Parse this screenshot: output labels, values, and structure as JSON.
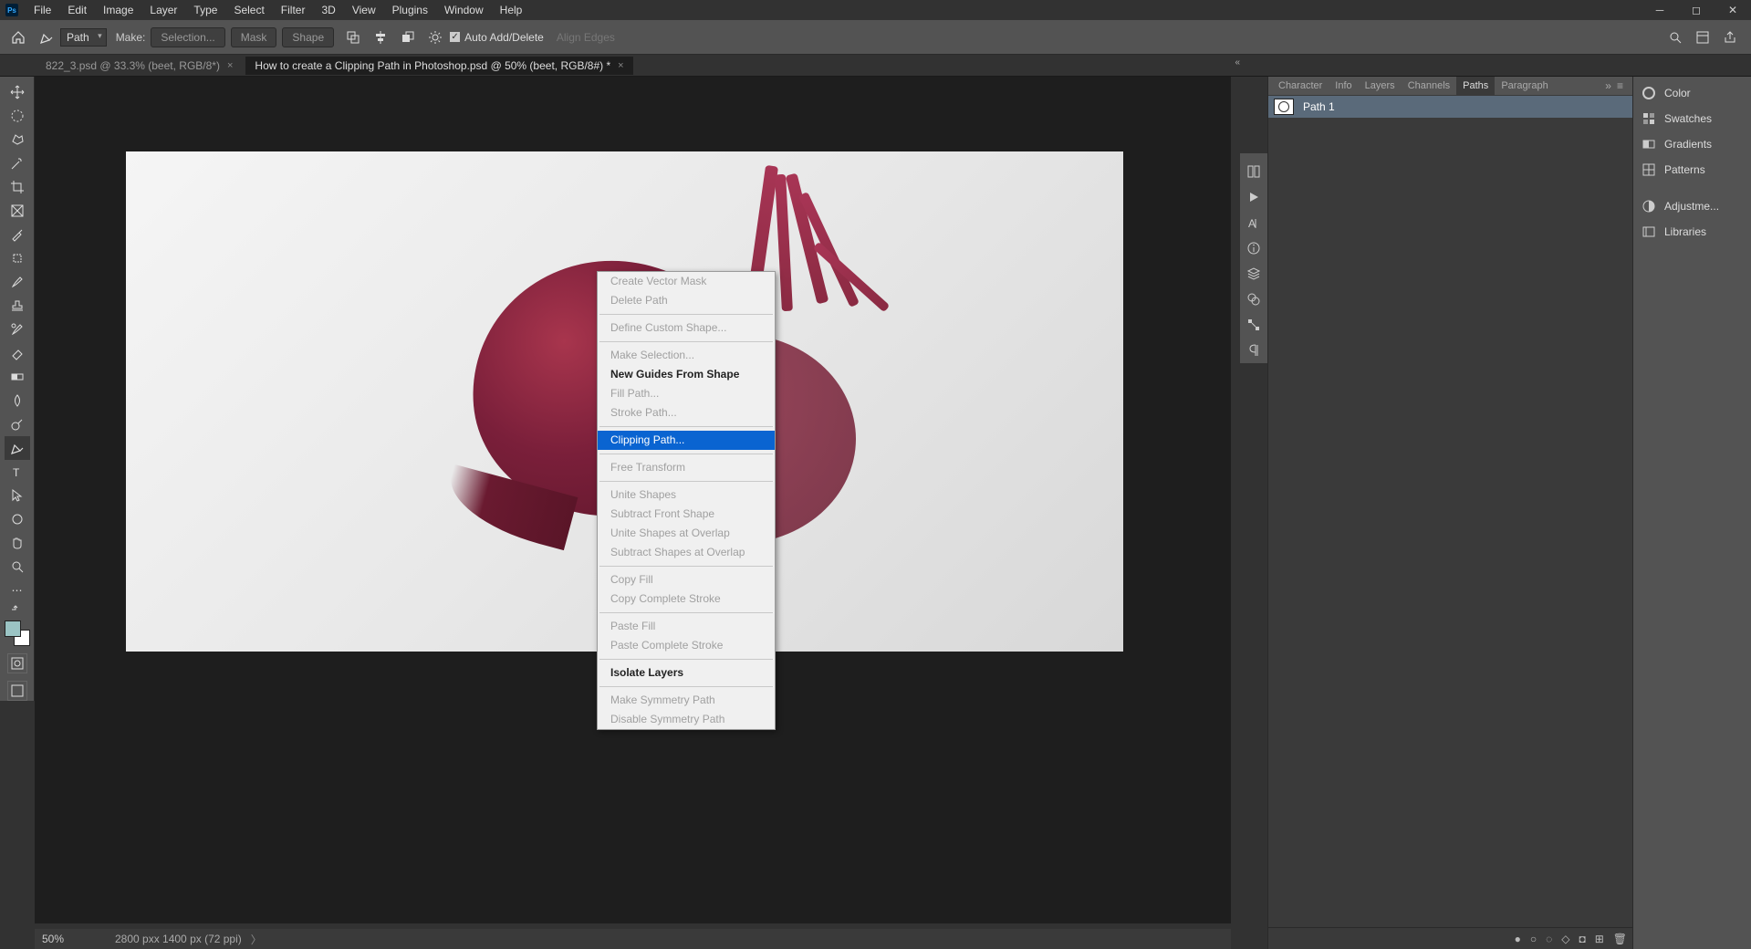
{
  "menubar": [
    "File",
    "Edit",
    "Image",
    "Layer",
    "Type",
    "Select",
    "Filter",
    "3D",
    "View",
    "Plugins",
    "Window",
    "Help"
  ],
  "optionsbar": {
    "mode": "Path",
    "make_label": "Make:",
    "selection_btn": "Selection...",
    "mask_btn": "Mask",
    "shape_btn": "Shape",
    "auto_add_delete": "Auto Add/Delete",
    "align_edges": "Align Edges"
  },
  "doc_tabs": [
    {
      "label": "822_3.psd @ 33.3% (beet, RGB/8*)",
      "active": false
    },
    {
      "label": "How to create a Clipping Path in Photoshop.psd @ 50% (beet, RGB/8#) *",
      "active": true
    }
  ],
  "context_menu": {
    "groups": [
      [
        {
          "label": "Create Vector Mask",
          "enabled": false
        },
        {
          "label": "Delete Path",
          "enabled": false
        }
      ],
      [
        {
          "label": "Define Custom Shape...",
          "enabled": false
        }
      ],
      [
        {
          "label": "Make Selection...",
          "enabled": false
        },
        {
          "label": "New Guides From Shape",
          "enabled": true,
          "bold": true
        },
        {
          "label": "Fill Path...",
          "enabled": false
        },
        {
          "label": "Stroke Path...",
          "enabled": false
        }
      ],
      [
        {
          "label": "Clipping Path...",
          "enabled": true,
          "highlighted": true
        }
      ],
      [
        {
          "label": "Free Transform",
          "enabled": false
        }
      ],
      [
        {
          "label": "Unite Shapes",
          "enabled": false
        },
        {
          "label": "Subtract Front Shape",
          "enabled": false
        },
        {
          "label": "Unite Shapes at Overlap",
          "enabled": false
        },
        {
          "label": "Subtract Shapes at Overlap",
          "enabled": false
        }
      ],
      [
        {
          "label": "Copy Fill",
          "enabled": false
        },
        {
          "label": "Copy Complete Stroke",
          "enabled": false
        }
      ],
      [
        {
          "label": "Paste Fill",
          "enabled": false
        },
        {
          "label": "Paste Complete Stroke",
          "enabled": false
        }
      ],
      [
        {
          "label": "Isolate Layers",
          "enabled": true,
          "bold": true
        }
      ],
      [
        {
          "label": "Make Symmetry Path",
          "enabled": false
        },
        {
          "label": "Disable Symmetry Path",
          "enabled": false
        }
      ]
    ]
  },
  "right_panel_items": [
    "Color",
    "Swatches",
    "Gradients",
    "Patterns",
    "Adjustme...",
    "Libraries"
  ],
  "paths_panel": {
    "tabs": [
      "Character",
      "Info",
      "Layers",
      "Channels",
      "Paths",
      "Paragraph"
    ],
    "active_tab": "Paths",
    "items": [
      {
        "name": "Path 1"
      }
    ]
  },
  "statusbar": {
    "zoom": "50%",
    "docinfo": "2800 pxx 1400 px (72 ppi)"
  }
}
